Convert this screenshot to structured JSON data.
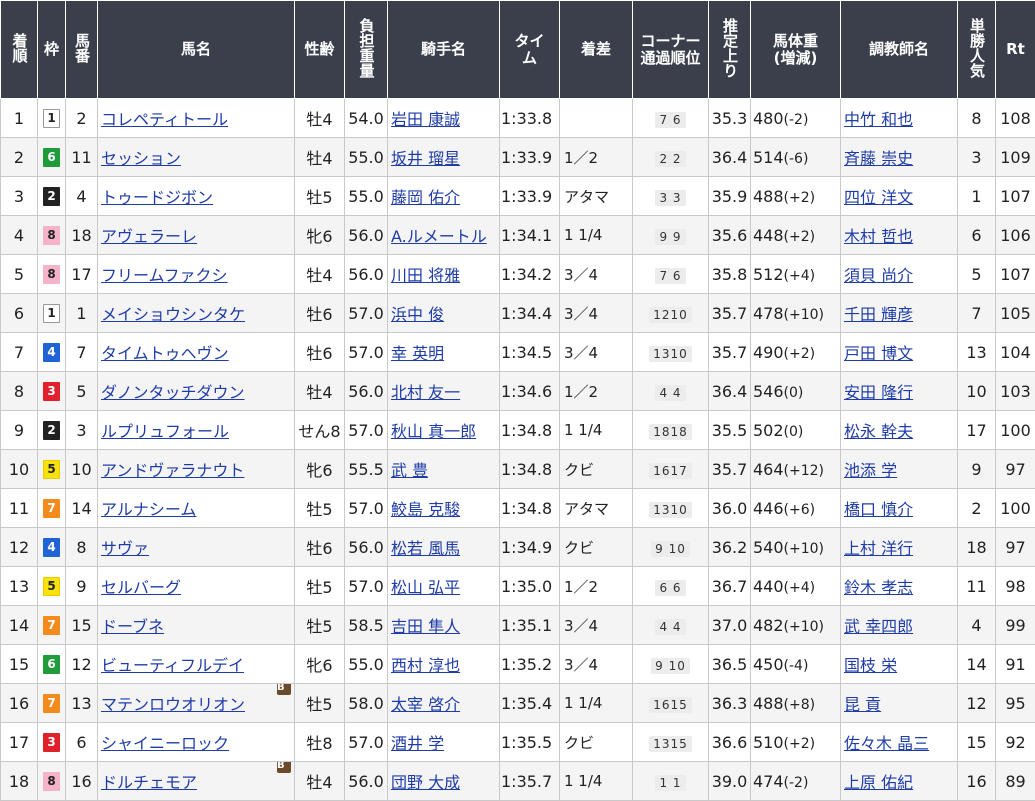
{
  "headers": {
    "rank": "着順",
    "waku": "枠",
    "umaban": "馬番",
    "horse": "馬名",
    "sexage": "性齢",
    "load": "負担重量",
    "jockey": "騎手名",
    "time": "タイム",
    "margin": "着差",
    "corner": "コーナー通過順位",
    "last3f": "推定上り",
    "weight": "馬体重(増減)",
    "trainer": "調教師名",
    "pop": "単勝人気",
    "rt": "Rt"
  },
  "blinker_label": "B",
  "waku_colors": {
    "1": {
      "bg": "#ffffff",
      "fg": "#222222",
      "border": "#999999"
    },
    "2": {
      "bg": "#222222",
      "fg": "#ffffff",
      "border": "#222222"
    },
    "3": {
      "bg": "#e0202a",
      "fg": "#ffffff",
      "border": "#e0202a"
    },
    "4": {
      "bg": "#1f63d6",
      "fg": "#ffffff",
      "border": "#1f63d6"
    },
    "5": {
      "bg": "#f8e10d",
      "fg": "#222222",
      "border": "#e6cc00"
    },
    "6": {
      "bg": "#1f9b3a",
      "fg": "#ffffff",
      "border": "#1f9b3a"
    },
    "7": {
      "bg": "#f28a1c",
      "fg": "#ffffff",
      "border": "#f28a1c"
    },
    "8": {
      "bg": "#f5b3c8",
      "fg": "#222222",
      "border": "#f5b3c8"
    }
  },
  "rows": [
    {
      "rank": "1",
      "waku": "1",
      "umaban": "2",
      "horse": "コレペティトール",
      "blinker": false,
      "sexage": "牡4",
      "load": "54.0",
      "jockey": "岩田 康誠",
      "time": "1:33.8",
      "margin": "",
      "corner": "7 6",
      "last3f": "35.3",
      "weight": "480",
      "diff": "(-2)",
      "trainer": "中竹 和也",
      "pop": "8",
      "rt": "108"
    },
    {
      "rank": "2",
      "waku": "6",
      "umaban": "11",
      "horse": "セッション",
      "blinker": false,
      "sexage": "牡4",
      "load": "55.0",
      "jockey": "坂井 瑠星",
      "time": "1:33.9",
      "margin": "1／2",
      "corner": "2 2",
      "last3f": "36.4",
      "weight": "514",
      "diff": "(-6)",
      "trainer": "斉藤 崇史",
      "pop": "3",
      "rt": "109"
    },
    {
      "rank": "3",
      "waku": "2",
      "umaban": "4",
      "horse": "トゥードジボン",
      "blinker": false,
      "sexage": "牡5",
      "load": "55.0",
      "jockey": "藤岡 佑介",
      "time": "1:33.9",
      "margin": "アタマ",
      "corner": "3 3",
      "last3f": "35.9",
      "weight": "488",
      "diff": "(+2)",
      "trainer": "四位 洋文",
      "pop": "1",
      "rt": "107"
    },
    {
      "rank": "4",
      "waku": "8",
      "umaban": "18",
      "horse": "アヴェラーレ",
      "blinker": false,
      "sexage": "牝6",
      "load": "56.0",
      "jockey": "A.ルメートル",
      "time": "1:34.1",
      "margin": "1 1/4",
      "corner": "9 9",
      "last3f": "35.6",
      "weight": "448",
      "diff": "(+2)",
      "trainer": "木村 哲也",
      "pop": "6",
      "rt": "106"
    },
    {
      "rank": "5",
      "waku": "8",
      "umaban": "17",
      "horse": "フリームファクシ",
      "blinker": false,
      "sexage": "牡4",
      "load": "56.0",
      "jockey": "川田 将雅",
      "time": "1:34.2",
      "margin": "3／4",
      "corner": "7 6",
      "last3f": "35.8",
      "weight": "512",
      "diff": "(+4)",
      "trainer": "須貝 尚介",
      "pop": "5",
      "rt": "107"
    },
    {
      "rank": "6",
      "waku": "1",
      "umaban": "1",
      "horse": "メイショウシンタケ",
      "blinker": false,
      "sexage": "牡6",
      "load": "57.0",
      "jockey": "浜中 俊",
      "time": "1:34.4",
      "margin": "3／4",
      "corner": "1210",
      "last3f": "35.7",
      "weight": "478",
      "diff": "(+10)",
      "trainer": "千田 輝彦",
      "pop": "7",
      "rt": "105"
    },
    {
      "rank": "7",
      "waku": "4",
      "umaban": "7",
      "horse": "タイムトゥヘヴン",
      "blinker": false,
      "sexage": "牡6",
      "load": "57.0",
      "jockey": "幸 英明",
      "time": "1:34.5",
      "margin": "3／4",
      "corner": "1310",
      "last3f": "35.7",
      "weight": "490",
      "diff": "(+2)",
      "trainer": "戸田 博文",
      "pop": "13",
      "rt": "104"
    },
    {
      "rank": "8",
      "waku": "3",
      "umaban": "5",
      "horse": "ダノンタッチダウン",
      "blinker": false,
      "sexage": "牡4",
      "load": "56.0",
      "jockey": "北村 友一",
      "time": "1:34.6",
      "margin": "1／2",
      "corner": "4 4",
      "last3f": "36.4",
      "weight": "546",
      "diff": "(0)",
      "trainer": "安田 隆行",
      "pop": "10",
      "rt": "103"
    },
    {
      "rank": "9",
      "waku": "2",
      "umaban": "3",
      "horse": "ルプリュフォール",
      "blinker": false,
      "sexage": "せん8",
      "load": "57.0",
      "jockey": "秋山 真一郎",
      "time": "1:34.8",
      "margin": "1 1/4",
      "corner": "1818",
      "last3f": "35.5",
      "weight": "502",
      "diff": "(0)",
      "trainer": "松永 幹夫",
      "pop": "17",
      "rt": "100"
    },
    {
      "rank": "10",
      "waku": "5",
      "umaban": "10",
      "horse": "アンドヴァラナウト",
      "blinker": false,
      "sexage": "牝6",
      "load": "55.5",
      "jockey": "武 豊",
      "time": "1:34.8",
      "margin": "クビ",
      "corner": "1617",
      "last3f": "35.7",
      "weight": "464",
      "diff": "(+12)",
      "trainer": "池添 学",
      "pop": "9",
      "rt": "97"
    },
    {
      "rank": "11",
      "waku": "7",
      "umaban": "14",
      "horse": "アルナシーム",
      "blinker": false,
      "sexage": "牡5",
      "load": "57.0",
      "jockey": "鮫島 克駿",
      "time": "1:34.8",
      "margin": "アタマ",
      "corner": "1310",
      "last3f": "36.0",
      "weight": "446",
      "diff": "(+6)",
      "trainer": "橋口 慎介",
      "pop": "2",
      "rt": "100"
    },
    {
      "rank": "12",
      "waku": "4",
      "umaban": "8",
      "horse": "サヴァ",
      "blinker": false,
      "sexage": "牡6",
      "load": "56.0",
      "jockey": "松若 風馬",
      "time": "1:34.9",
      "margin": "クビ",
      "corner": "9 10",
      "last3f": "36.2",
      "weight": "540",
      "diff": "(+10)",
      "trainer": "上村 洋行",
      "pop": "18",
      "rt": "97"
    },
    {
      "rank": "13",
      "waku": "5",
      "umaban": "9",
      "horse": "セルバーグ",
      "blinker": false,
      "sexage": "牡5",
      "load": "57.0",
      "jockey": "松山 弘平",
      "time": "1:35.0",
      "margin": "1／2",
      "corner": "6 6",
      "last3f": "36.7",
      "weight": "440",
      "diff": "(+4)",
      "trainer": "鈴木 孝志",
      "pop": "11",
      "rt": "98"
    },
    {
      "rank": "14",
      "waku": "7",
      "umaban": "15",
      "horse": "ドーブネ",
      "blinker": false,
      "sexage": "牡5",
      "load": "58.5",
      "jockey": "吉田 隼人",
      "time": "1:35.1",
      "margin": "3／4",
      "corner": "4 4",
      "last3f": "37.0",
      "weight": "482",
      "diff": "(+10)",
      "trainer": "武 幸四郎",
      "pop": "4",
      "rt": "99"
    },
    {
      "rank": "15",
      "waku": "6",
      "umaban": "12",
      "horse": "ビューティフルデイ",
      "blinker": false,
      "sexage": "牝6",
      "load": "55.0",
      "jockey": "西村 淳也",
      "time": "1:35.2",
      "margin": "3／4",
      "corner": "9 10",
      "last3f": "36.5",
      "weight": "450",
      "diff": "(-4)",
      "trainer": "国枝 栄",
      "pop": "14",
      "rt": "91"
    },
    {
      "rank": "16",
      "waku": "7",
      "umaban": "13",
      "horse": "マテンロウオリオン",
      "blinker": true,
      "sexage": "牡5",
      "load": "58.0",
      "jockey": "太宰 啓介",
      "time": "1:35.4",
      "margin": "1 1/4",
      "corner": "1615",
      "last3f": "36.3",
      "weight": "488",
      "diff": "(+8)",
      "trainer": "昆 貢",
      "pop": "12",
      "rt": "95"
    },
    {
      "rank": "17",
      "waku": "3",
      "umaban": "6",
      "horse": "シャイニーロック",
      "blinker": false,
      "sexage": "牡8",
      "load": "57.0",
      "jockey": "酒井 学",
      "time": "1:35.5",
      "margin": "クビ",
      "corner": "1315",
      "last3f": "36.6",
      "weight": "510",
      "diff": "(+2)",
      "trainer": "佐々木 晶三",
      "pop": "15",
      "rt": "92"
    },
    {
      "rank": "18",
      "waku": "8",
      "umaban": "16",
      "horse": "ドルチェモア",
      "blinker": true,
      "sexage": "牡4",
      "load": "56.0",
      "jockey": "団野 大成",
      "time": "1:35.7",
      "margin": "1 1/4",
      "corner": "1 1",
      "last3f": "39.0",
      "weight": "474",
      "diff": "(-2)",
      "trainer": "上原 佑紀",
      "pop": "16",
      "rt": "89"
    }
  ]
}
